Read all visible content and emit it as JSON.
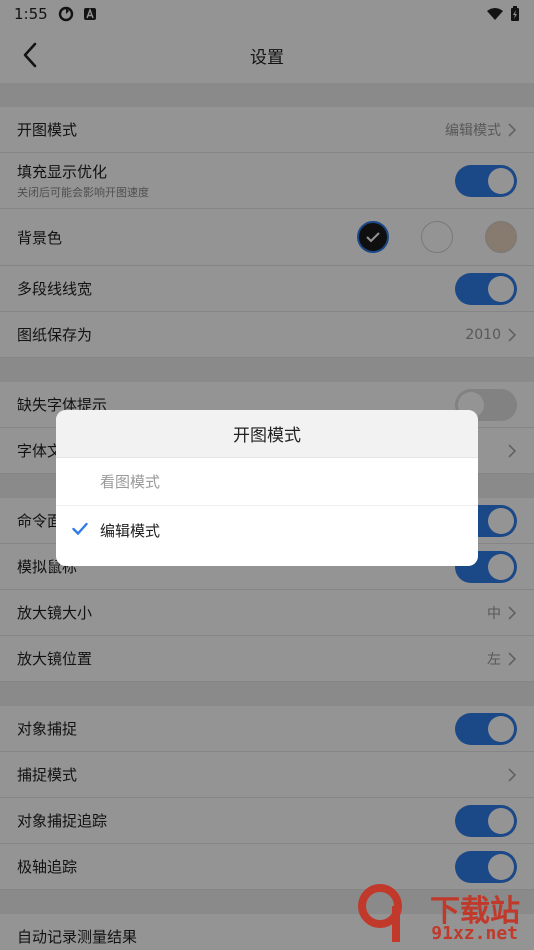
{
  "status_bar": {
    "time": "1:55"
  },
  "app_bar": {
    "title": "设置"
  },
  "settings": {
    "open_mode": {
      "label": "开图模式",
      "value": "编辑模式"
    },
    "fill_optimize": {
      "label": "填充显示优化",
      "sub": "关闭后可能会影响开图速度",
      "on": true
    },
    "background": {
      "label": "背景色",
      "swatch_colors": [
        "#1b1b1b",
        "#ffffff",
        "#e8d3c0"
      ],
      "selected_index": 0
    },
    "polyline_width": {
      "label": "多段线线宽",
      "on": true
    },
    "save_as": {
      "label": "图纸保存为",
      "value": "2010"
    },
    "missing_font": {
      "label": "缺失字体提示",
      "on": false
    },
    "font_file": {
      "label": "字体文"
    },
    "command_panel": {
      "label": "命令面",
      "on": true
    },
    "simulate_mouse": {
      "label": "模拟鼠标",
      "on": true
    },
    "magnifier_size": {
      "label": "放大镜大小",
      "value": "中"
    },
    "magnifier_pos": {
      "label": "放大镜位置",
      "value": "左"
    },
    "object_snap": {
      "label": "对象捕捉",
      "on": true
    },
    "snap_mode": {
      "label": "捕捉模式"
    },
    "snap_tracking": {
      "label": "对象捕捉追踪",
      "on": true
    },
    "polar_tracking": {
      "label": "极轴追踪",
      "on": true
    },
    "auto_record": {
      "label": "自动记录测量结果"
    }
  },
  "dialog": {
    "title": "开图模式",
    "options": [
      {
        "label": "看图模式",
        "selected": false
      },
      {
        "label": "编辑模式",
        "selected": true
      }
    ]
  },
  "watermark": {
    "line1": "下载站",
    "line2": "91xz.net"
  },
  "colors": {
    "accent": "#2f7ce8",
    "watermark": "#c0392b"
  }
}
